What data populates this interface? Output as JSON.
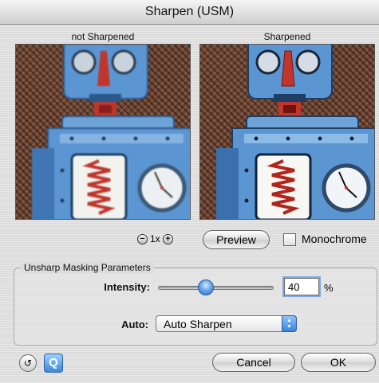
{
  "window": {
    "title": "Sharpen (USM)"
  },
  "preview": {
    "left_label": "not Sharpened",
    "right_label": "Sharpened",
    "zoom_level": "1x",
    "zoom_out_icon": "minus-circle-icon",
    "zoom_in_icon": "plus-circle-icon"
  },
  "controls": {
    "preview_button": "Preview",
    "monochrome_label": "Monochrome",
    "monochrome_checked": false
  },
  "params": {
    "group_title": "Unsharp Masking Parameters",
    "intensity_label": "Intensity:",
    "intensity_value": "40",
    "intensity_unit": "%",
    "intensity_slider_level": 0.4,
    "auto_label": "Auto:",
    "auto_selected": "Auto Sharpen"
  },
  "footer": {
    "cancel_button": "Cancel",
    "ok_button": "OK",
    "reset_icon": "reset-icon",
    "q_icon_glyph": "Q"
  },
  "colors": {
    "accent": "#3c83d8",
    "robot_blue": "#5b95d2",
    "robot_red": "#c0362c"
  }
}
